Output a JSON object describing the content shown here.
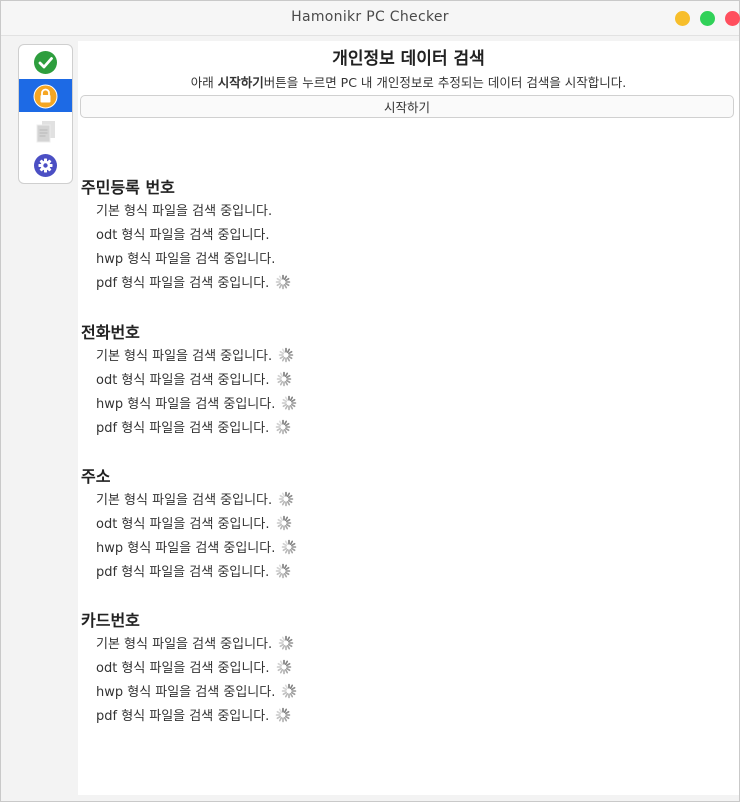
{
  "window": {
    "title": "Hamonikr PC Checker"
  },
  "sidebar": {
    "items": [
      {
        "icon": "check-circle-icon",
        "color": "#2e9e3e"
      },
      {
        "icon": "lock-icon",
        "color": "#f5a623",
        "selected": true
      },
      {
        "icon": "document-icon",
        "color": "#c8c8c8"
      },
      {
        "icon": "gear-icon",
        "color": "#4b4fc4"
      }
    ]
  },
  "header": {
    "title": "개인정보 데이터 검색",
    "desc_prefix": "아래 ",
    "desc_bold": "시작하기",
    "desc_suffix": "버튼을 누르면 PC 내 개인정보로 추정되는 데이터 검색을 시작합니다.",
    "start_label": "시작하기"
  },
  "sections": [
    {
      "title": "주민등록 번호",
      "rows": [
        {
          "text": "기본 형식 파일을 검색 중입니다.",
          "loading": false
        },
        {
          "text": "odt 형식 파일을 검색 중입니다.",
          "loading": false
        },
        {
          "text": "hwp 형식 파일을 검색 중입니다.",
          "loading": false
        },
        {
          "text": "pdf 형식 파일을 검색 중입니다.",
          "loading": true
        }
      ]
    },
    {
      "title": "전화번호",
      "rows": [
        {
          "text": "기본 형식 파일을 검색 중입니다.",
          "loading": true
        },
        {
          "text": "odt 형식 파일을 검색 중입니다.",
          "loading": true
        },
        {
          "text": "hwp 형식 파일을 검색 중입니다.",
          "loading": true
        },
        {
          "text": "pdf 형식 파일을 검색 중입니다.",
          "loading": true
        }
      ]
    },
    {
      "title": "주소",
      "rows": [
        {
          "text": "기본 형식 파일을 검색 중입니다.",
          "loading": true
        },
        {
          "text": "odt 형식 파일을 검색 중입니다.",
          "loading": true
        },
        {
          "text": "hwp 형식 파일을 검색 중입니다.",
          "loading": true
        },
        {
          "text": "pdf 형식 파일을 검색 중입니다.",
          "loading": true
        }
      ]
    },
    {
      "title": "카드번호",
      "rows": [
        {
          "text": "기본 형식 파일을 검색 중입니다.",
          "loading": true
        },
        {
          "text": "odt 형식 파일을 검색 중입니다.",
          "loading": true
        },
        {
          "text": "hwp 형식 파일을 검색 중입니다.",
          "loading": true
        },
        {
          "text": "pdf 형식 파일을 검색 중입니다.",
          "loading": true
        }
      ]
    }
  ]
}
